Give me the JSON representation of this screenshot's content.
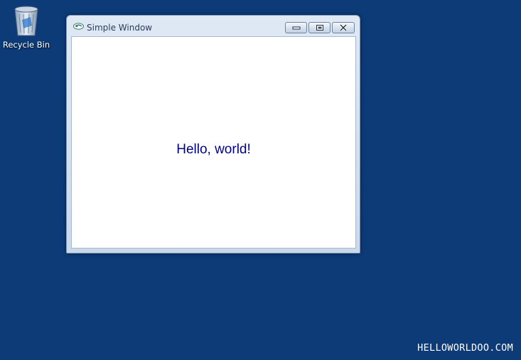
{
  "desktop": {
    "background_color": "#0c3b78",
    "icons": [
      {
        "label": "Recycle Bin",
        "icon": "recycle-bin-icon"
      }
    ]
  },
  "window": {
    "title": "Simple Window",
    "app_icon": "app-icon",
    "controls": {
      "minimize": "minimize-icon",
      "maximize": "maximize-icon",
      "close": "close-icon"
    },
    "content": {
      "text": "Hello, world!",
      "text_color": "#00008b"
    }
  },
  "watermark": {
    "text": "HELLOWORLDOO.COM"
  }
}
